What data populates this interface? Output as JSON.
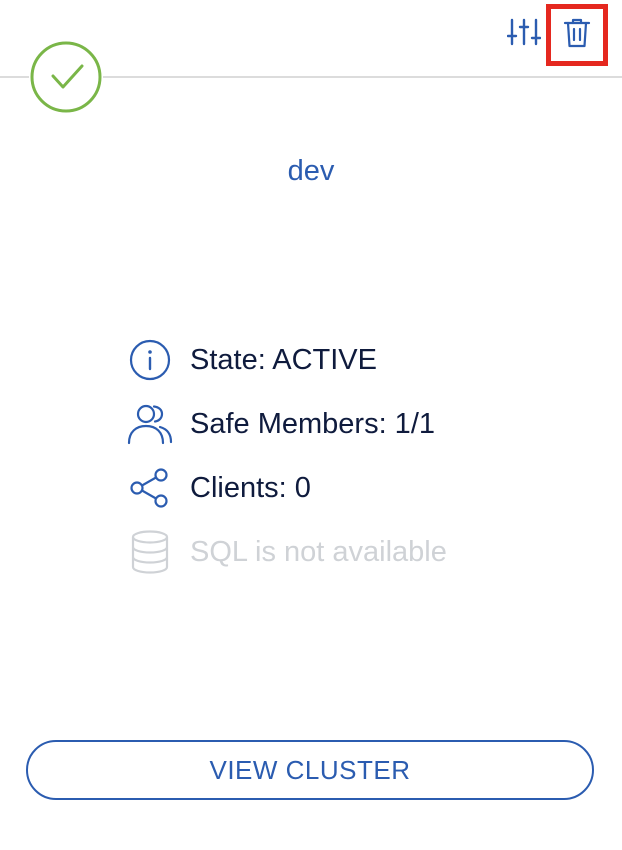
{
  "cluster": {
    "name": "dev",
    "status_icon": "check-circle-icon"
  },
  "toolbar": {
    "settings_icon": "sliders-icon",
    "delete_icon": "trash-icon"
  },
  "info": {
    "state": "State: ACTIVE",
    "members": "Safe Members: 1/1",
    "clients": "Clients: 0",
    "sql": "SQL is not available"
  },
  "actions": {
    "view_cluster": "VIEW CLUSTER"
  },
  "colors": {
    "accent": "#2b5cb0",
    "success": "#7ab648",
    "text": "#0f1b3d",
    "disabled": "#cfd2d6",
    "highlight": "#e5281f"
  }
}
